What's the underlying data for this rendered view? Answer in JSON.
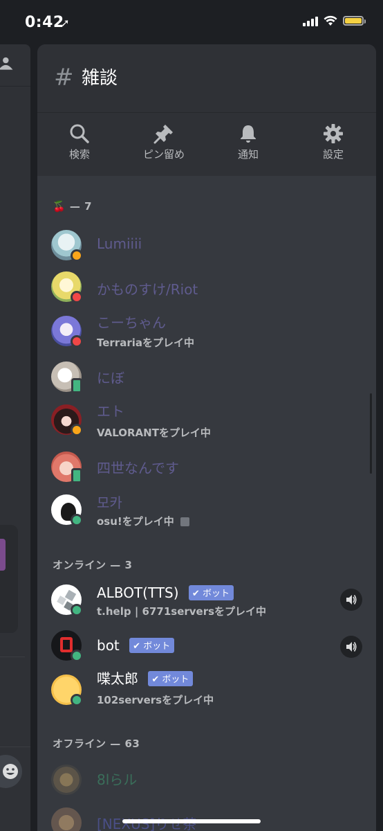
{
  "status_bar": {
    "time": "0:42",
    "location_icon": "location-arrow-icon"
  },
  "channel": {
    "hash": "#",
    "name": "雑談"
  },
  "toolbar": [
    {
      "label": "検索",
      "icon": "search-icon"
    },
    {
      "label": "ピン留め",
      "icon": "pin-icon"
    },
    {
      "label": "通知",
      "icon": "bell-icon"
    },
    {
      "label": "設定",
      "icon": "gear-icon"
    }
  ],
  "sections": {
    "cherry": {
      "emoji": "🍒",
      "count": "— 7"
    },
    "online": {
      "label": "オンライン — 3"
    },
    "offline": {
      "label": "オフライン — 63"
    }
  },
  "members_cherry": [
    {
      "name": "Lumiiii",
      "status": "idle"
    },
    {
      "name": "かものすけ/Riot",
      "status": "dnd"
    },
    {
      "name": "こーちゃん",
      "activity": "Terrariaをプレイ中",
      "status": "dnd"
    },
    {
      "name": "にぼ",
      "status": "mobile"
    },
    {
      "name": "エト",
      "activity": "VALORANTをプレイ中",
      "status": "idle"
    },
    {
      "name": "四世なんです",
      "status": "mobile"
    },
    {
      "name": "모카",
      "activity": "osu!をプレイ中",
      "status": "online"
    }
  ],
  "members_online": [
    {
      "name": "ALBOT(TTS)",
      "badge": "ボット",
      "activity": "t.help | 6771serversをプレイ中"
    },
    {
      "name": "bot",
      "badge": "ボット"
    },
    {
      "name": "喋太郎",
      "badge": "ボット",
      "activity": "102serversをプレイ中"
    }
  ],
  "members_offline": [
    {
      "name": "8lらル"
    },
    {
      "name": "[NEXUS]りせ茶"
    }
  ],
  "colors": {
    "online": "#43b581",
    "idle": "#faa61a",
    "dnd": "#f04747",
    "bot_badge": "#7289da"
  }
}
